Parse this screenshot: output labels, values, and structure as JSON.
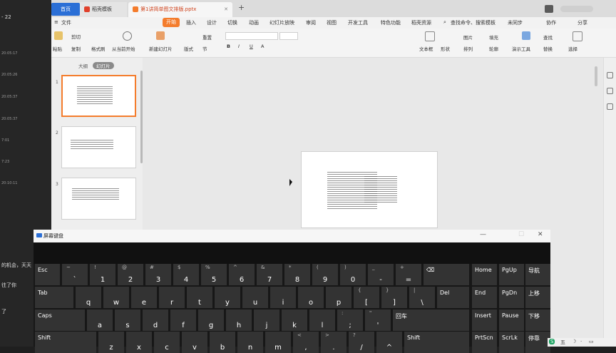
{
  "left_panel": {
    "rows": [
      {
        "text": "- 22"
      },
      {
        "text": "20:05:17"
      },
      {
        "text": "20:05:26"
      },
      {
        "text": "20:05:37"
      },
      {
        "text": "20:05:37"
      },
      {
        "text": "20:05:37"
      },
      {
        "text": "7:01"
      },
      {
        "text": "7:23"
      },
      {
        "text": "20:10:11"
      }
    ],
    "chat_lines": [
      "的机会，天天",
      "往了你",
      "了"
    ]
  },
  "tabs": {
    "home": "首页",
    "template": "稻壳模板",
    "file": "第1讲简单图文排版.pptx"
  },
  "menu": {
    "file": "文件",
    "start": "开始",
    "insert": "插入",
    "design": "设计",
    "transition": "切换",
    "animation": "动画",
    "slideshow": "幻灯片放映",
    "review": "审阅",
    "view": "视图",
    "developer": "开发工具",
    "special": "特色功能",
    "docer": "稻壳资源",
    "search": "查找命令、搜索模板",
    "sync": "未同步",
    "collab": "协作",
    "share": "分享"
  },
  "toolbar": {
    "paste": "粘贴",
    "cut": "剪切",
    "copy": "复制",
    "format_painter": "格式刷",
    "from_current": "从当前开始",
    "new_slide": "新建幻灯片",
    "layout": "版式",
    "section": "节",
    "reset": "重置",
    "textbox": "文本框",
    "shapes": "形状",
    "arrange": "排列",
    "picture": "图片",
    "fill": "填充",
    "outline": "轮廓",
    "presenter": "演示工具",
    "replace": "替换",
    "find": "查找",
    "select": "选择"
  },
  "view_tabs": {
    "outline": "大纲",
    "slides": "幻灯片"
  },
  "slide_numbers": [
    "1",
    "2",
    "3"
  ],
  "osk": {
    "title": "屏幕键盘",
    "rows": [
      [
        {
          "main": "Esc",
          "shift": ""
        },
        {
          "main": "`",
          "shift": "~"
        },
        {
          "main": "1",
          "shift": "!"
        },
        {
          "main": "2",
          "shift": "@"
        },
        {
          "main": "3",
          "shift": "#"
        },
        {
          "main": "4",
          "shift": "$"
        },
        {
          "main": "5",
          "shift": "%"
        },
        {
          "main": "6",
          "shift": "^"
        },
        {
          "main": "7",
          "shift": "&"
        },
        {
          "main": "8",
          "shift": "*"
        },
        {
          "main": "9",
          "shift": "("
        },
        {
          "main": "0",
          "shift": ")"
        },
        {
          "main": "-",
          "shift": "_"
        },
        {
          "main": "=",
          "shift": "+"
        },
        {
          "main": "⌫",
          "shift": ""
        },
        {
          "main": "Home",
          "shift": ""
        },
        {
          "main": "PgUp",
          "shift": ""
        },
        {
          "main": "导航",
          "shift": ""
        }
      ],
      [
        {
          "main": "Tab",
          "shift": ""
        },
        {
          "main": "q",
          "shift": ""
        },
        {
          "main": "w",
          "shift": ""
        },
        {
          "main": "e",
          "shift": ""
        },
        {
          "main": "r",
          "shift": ""
        },
        {
          "main": "t",
          "shift": ""
        },
        {
          "main": "y",
          "shift": ""
        },
        {
          "main": "u",
          "shift": ""
        },
        {
          "main": "i",
          "shift": ""
        },
        {
          "main": "o",
          "shift": ""
        },
        {
          "main": "p",
          "shift": ""
        },
        {
          "main": "[",
          "shift": "{"
        },
        {
          "main": "]",
          "shift": "}"
        },
        {
          "main": "\\",
          "shift": "|"
        },
        {
          "main": "Del",
          "shift": ""
        },
        {
          "main": "End",
          "shift": ""
        },
        {
          "main": "PgDn",
          "shift": ""
        },
        {
          "main": "上移",
          "shift": ""
        }
      ],
      [
        {
          "main": "Caps",
          "shift": ""
        },
        {
          "main": "a",
          "shift": ""
        },
        {
          "main": "s",
          "shift": ""
        },
        {
          "main": "d",
          "shift": ""
        },
        {
          "main": "f",
          "shift": ""
        },
        {
          "main": "g",
          "shift": ""
        },
        {
          "main": "h",
          "shift": ""
        },
        {
          "main": "j",
          "shift": ""
        },
        {
          "main": "k",
          "shift": ""
        },
        {
          "main": "l",
          "shift": ""
        },
        {
          "main": ";",
          "shift": ":"
        },
        {
          "main": "'",
          "shift": "\""
        },
        {
          "main": "回车",
          "shift": ""
        },
        {
          "main": "Insert",
          "shift": ""
        },
        {
          "main": "Pause",
          "shift": ""
        },
        {
          "main": "下移",
          "shift": ""
        }
      ],
      [
        {
          "main": "Shift",
          "shift": ""
        },
        {
          "main": "z",
          "shift": ""
        },
        {
          "main": "x",
          "shift": ""
        },
        {
          "main": "c",
          "shift": ""
        },
        {
          "main": "v",
          "shift": ""
        },
        {
          "main": "b",
          "shift": ""
        },
        {
          "main": "n",
          "shift": ""
        },
        {
          "main": "m",
          "shift": ""
        },
        {
          "main": ",",
          "shift": "<"
        },
        {
          "main": ".",
          "shift": ">"
        },
        {
          "main": "/",
          "shift": "?"
        },
        {
          "main": "^",
          "shift": ""
        },
        {
          "main": "Shift",
          "shift": ""
        },
        {
          "main": "PrtScn",
          "shift": ""
        },
        {
          "main": "ScrLk",
          "shift": ""
        },
        {
          "main": "停靠",
          "shift": ""
        }
      ]
    ]
  },
  "tray": {
    "ime": "五"
  },
  "colors": {
    "accent_orange": "#f47c2c",
    "accent_blue": "#2b6fd6",
    "osk_key": "#333333"
  }
}
